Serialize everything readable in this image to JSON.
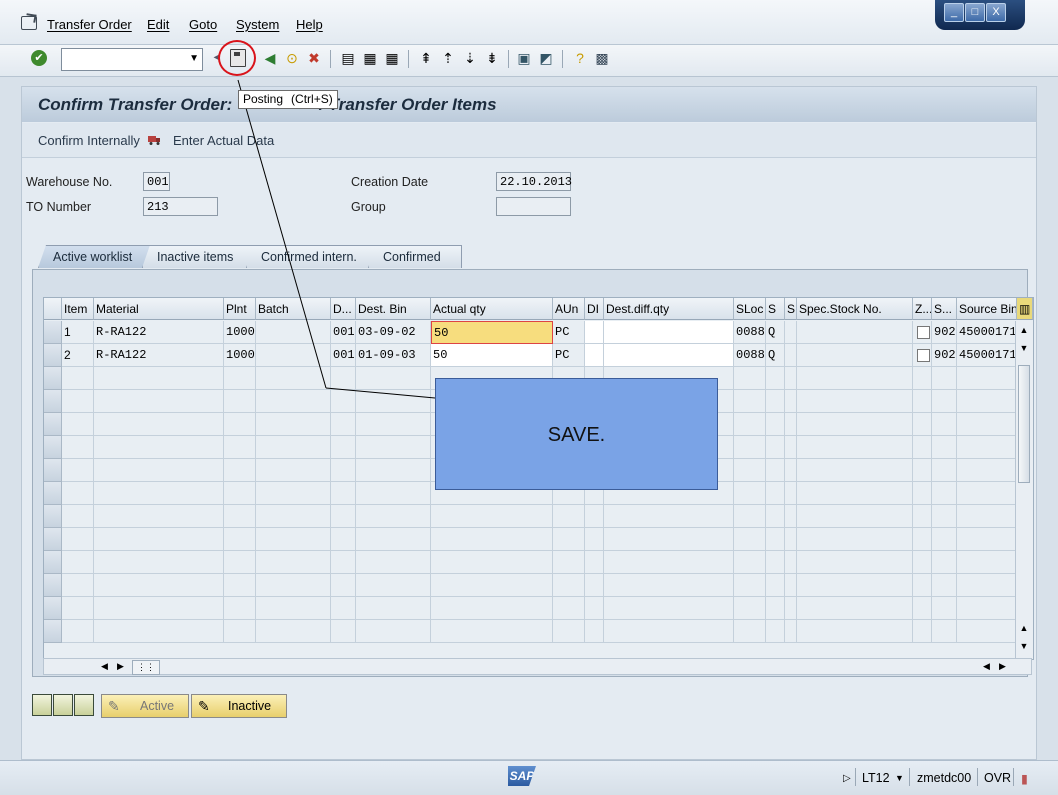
{
  "menu": {
    "items": [
      "Transfer Order",
      "Edit",
      "Goto",
      "System",
      "Help"
    ]
  },
  "window_controls": {
    "minimize": "_",
    "maximize": "□",
    "close": "X"
  },
  "toolbar": {
    "command_field_value": "",
    "save_icon": "floppy-disk-icon",
    "tooltip_label": "Posting",
    "tooltip_shortcut": "(Ctrl+S)"
  },
  "screen": {
    "title_left": "Confirm Transfer Order:",
    "title_right": "f Transfer Order Items",
    "app_toolbar": {
      "confirm_internally": "Confirm Internally",
      "enter_actual_data": "Enter Actual Data"
    }
  },
  "header": {
    "warehouse_label": "Warehouse No.",
    "warehouse_value": "001",
    "to_number_label": "TO Number",
    "to_number_value": "213",
    "creation_date_label": "Creation Date",
    "creation_date_value": "22.10.2013",
    "group_label": "Group",
    "group_value": ""
  },
  "tabs": [
    {
      "label": "Active worklist",
      "active": true
    },
    {
      "label": "Inactive items",
      "active": false
    },
    {
      "label": "Confirmed intern.",
      "active": false
    },
    {
      "label": "Confirmed",
      "active": false
    }
  ],
  "table": {
    "columns": [
      "Item",
      "Material",
      "Plnt",
      "Batch",
      "D...",
      "Dest. Bin",
      "Actual qty",
      "AUn",
      "DI",
      "Dest.diff.qty",
      "SLoc",
      "S",
      "S",
      "Spec.Stock No.",
      "Z...",
      "S...",
      "Source Bin"
    ],
    "rows": [
      {
        "item": "1",
        "material": "R-RA122",
        "plant": "1000",
        "batch": "",
        "d": "001",
        "dest_bin": "03-09-02",
        "actual_qty": "50",
        "aun": "PC",
        "di": "",
        "dest_diff_qty": "",
        "sloc": "0088",
        "s1": "Q",
        "s2": "",
        "spec_stock": "",
        "z": "",
        "s3": "902",
        "source_bin": "45000171"
      },
      {
        "item": "2",
        "material": "R-RA122",
        "plant": "1000",
        "batch": "",
        "d": "001",
        "dest_bin": "01-09-03",
        "actual_qty": "50",
        "aun": "PC",
        "di": "",
        "dest_diff_qty": "",
        "sloc": "0088",
        "s1": "Q",
        "s2": "",
        "spec_stock": "",
        "z": "",
        "s3": "902",
        "source_bin": "45000171"
      }
    ]
  },
  "buttons": {
    "active_label": "Active",
    "inactive_label": "Inactive"
  },
  "overlay": {
    "text": "SAVE."
  },
  "statusbar": {
    "logo": "SAP",
    "transaction": "LT12",
    "server": "zmetdc00",
    "mode": "OVR"
  }
}
